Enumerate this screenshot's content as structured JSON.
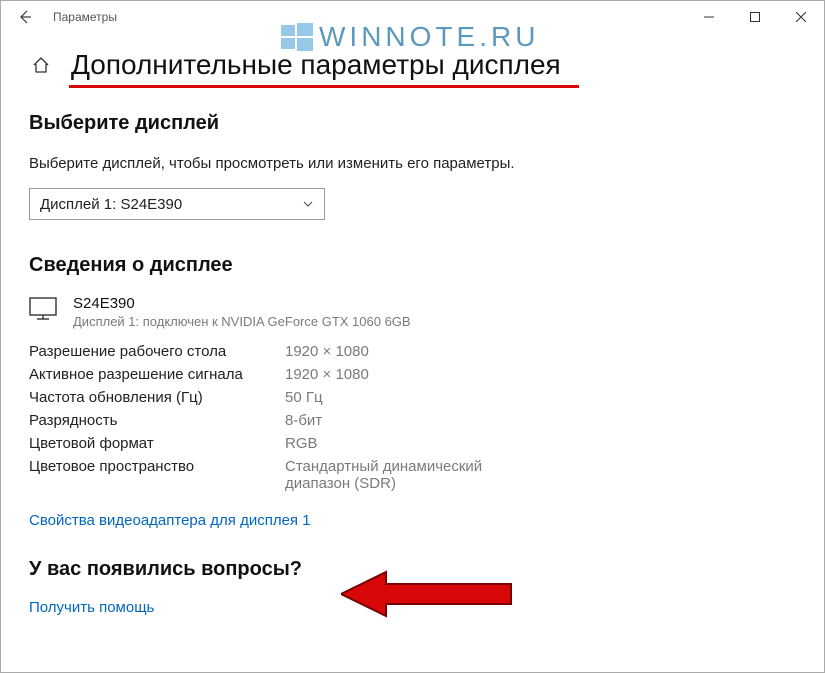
{
  "window": {
    "title": "Параметры"
  },
  "watermark": {
    "text": "WINNOTE.RU"
  },
  "page": {
    "title": "Дополнительные параметры дисплея",
    "select_heading": "Выберите дисплей",
    "select_desc": "Выберите дисплей, чтобы просмотреть или изменить его параметры.",
    "dropdown_value": "Дисплей 1: S24E390",
    "info_heading": "Сведения о дисплее",
    "display": {
      "name": "S24E390",
      "sub": "Дисплей 1: подключен к NVIDIA GeForce GTX 1060 6GB"
    },
    "specs": [
      {
        "label": "Разрешение рабочего стола",
        "value": "1920 × 1080"
      },
      {
        "label": "Активное разрешение сигнала",
        "value": "1920 × 1080"
      },
      {
        "label": "Частота обновления (Гц)",
        "value": "50 Гц"
      },
      {
        "label": "Разрядность",
        "value": "8-бит"
      },
      {
        "label": "Цветовой формат",
        "value": "RGB"
      },
      {
        "label": "Цветовое пространство",
        "value": "Стандартный динамический диапазон (SDR)"
      }
    ],
    "adapter_link": "Свойства видеоадаптера для дисплея 1",
    "questions_heading": "У вас появились вопросы?",
    "help_link": "Получить помощь"
  }
}
